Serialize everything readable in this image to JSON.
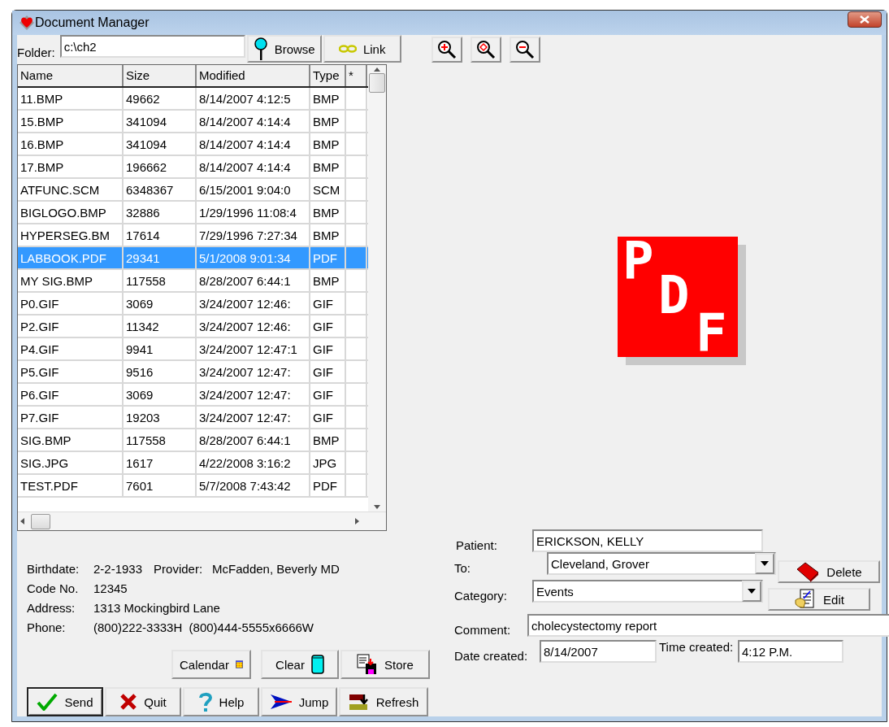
{
  "window": {
    "title": "Document Manager"
  },
  "folder": {
    "label": "Folder:",
    "value": "c:\\ch2"
  },
  "folder_buttons": [
    {
      "kind": "browse",
      "label": "Browse"
    },
    {
      "kind": "link",
      "label": "Link"
    }
  ],
  "zoom_buttons": [
    {
      "kind": "zoom-in"
    },
    {
      "kind": "zoom-reset"
    },
    {
      "kind": "zoom-out"
    }
  ],
  "file_list": {
    "columns": [
      "Name",
      "Size",
      "Modified",
      "Type",
      "*"
    ],
    "rows": [
      {
        "cells": [
          "11.BMP",
          "49662",
          "8/14/2007 4:12:5",
          "BMP"
        ],
        "selected": false
      },
      {
        "cells": [
          "15.BMP",
          "341094",
          "8/14/2007 4:14:4",
          "BMP"
        ],
        "selected": false
      },
      {
        "cells": [
          "16.BMP",
          "341094",
          "8/14/2007 4:14:4",
          "BMP"
        ],
        "selected": false
      },
      {
        "cells": [
          "17.BMP",
          "196662",
          "8/14/2007 4:14:4",
          "BMP"
        ],
        "selected": false
      },
      {
        "cells": [
          "ATFUNC.SCM",
          "6348367",
          "6/15/2001 9:04:0",
          "SCM"
        ],
        "selected": false
      },
      {
        "cells": [
          "BIGLOGO.BMP",
          "32886",
          "1/29/1996 11:08:4",
          "BMP"
        ],
        "selected": false
      },
      {
        "cells": [
          "HYPERSEG.BM",
          "17614",
          "7/29/1996 7:27:34",
          "BMP"
        ],
        "selected": false
      },
      {
        "cells": [
          "LABBOOK.PDF",
          "29341",
          "5/1/2008 9:01:34",
          "PDF"
        ],
        "selected": true
      },
      {
        "cells": [
          "MY SIG.BMP",
          "117558",
          "8/28/2007 6:44:1",
          "BMP"
        ],
        "selected": false
      },
      {
        "cells": [
          "P0.GIF",
          "3069",
          "3/24/2007 12:46:",
          "GIF"
        ],
        "selected": false
      },
      {
        "cells": [
          "P2.GIF",
          "11342",
          "3/24/2007 12:46:",
          "GIF"
        ],
        "selected": false
      },
      {
        "cells": [
          "P4.GIF",
          "9941",
          "3/24/2007 12:47:1",
          "GIF"
        ],
        "selected": false
      },
      {
        "cells": [
          "P5.GIF",
          "9516",
          "3/24/2007 12:47:",
          "GIF"
        ],
        "selected": false
      },
      {
        "cells": [
          "P6.GIF",
          "3069",
          "3/24/2007 12:47:",
          "GIF"
        ],
        "selected": false
      },
      {
        "cells": [
          "P7.GIF",
          "19203",
          "3/24/2007 12:47:",
          "GIF"
        ],
        "selected": false
      },
      {
        "cells": [
          "SIG.BMP",
          "117558",
          "8/28/2007 6:44:1",
          "BMP"
        ],
        "selected": false
      },
      {
        "cells": [
          "SIG.JPG",
          "1617",
          "4/22/2008 3:16:2",
          "JPG"
        ],
        "selected": false
      },
      {
        "cells": [
          "TEST.PDF",
          "7601",
          "5/7/2008 7:43:42",
          "PDF"
        ],
        "selected": false
      }
    ]
  },
  "preview": {
    "letters": [
      "P",
      "D",
      "F"
    ]
  },
  "patient_info": [
    {
      "fields": [
        {
          "label": "Birthdate:",
          "value": "2-2-1933"
        },
        {
          "label": "Provider:",
          "value": "McFadden, Beverly MD"
        }
      ]
    },
    {
      "fields": [
        {
          "label": "Code No.",
          "value": "12345"
        }
      ]
    },
    {
      "fields": [
        {
          "label": "Address:",
          "value": "1313 Mockingbird Lane"
        }
      ]
    },
    {
      "fields": [
        {
          "label": "Phone:",
          "value": "(800)222-3333H  (800)444-5555x6666W"
        }
      ]
    }
  ],
  "tool_buttons": [
    {
      "kind": "calendar",
      "label": "Calendar"
    },
    {
      "kind": "clear",
      "label": "Clear"
    },
    {
      "kind": "store",
      "label": "Store"
    }
  ],
  "action_buttons": [
    {
      "kind": "send",
      "label": "Send",
      "default": true
    },
    {
      "kind": "quit",
      "label": "Quit",
      "default": false
    },
    {
      "kind": "help",
      "label": "Help",
      "default": false
    },
    {
      "kind": "jump",
      "label": "Jump",
      "default": false
    },
    {
      "kind": "refresh",
      "label": "Refresh",
      "default": false
    }
  ],
  "form": {
    "patient": {
      "label": "Patient:",
      "value": "ERICKSON, KELLY"
    },
    "to": {
      "label": "To:",
      "value": "Cleveland, Grover"
    },
    "category": {
      "label": "Category:",
      "value": "Events"
    },
    "comment": {
      "label": "Comment:",
      "value": "cholecystectomy report"
    },
    "date_created": {
      "label": "Date created:",
      "value": "8/14/2007"
    },
    "time_created": {
      "label": "Time created:",
      "value": "4:12 P.M."
    }
  },
  "side_buttons": [
    {
      "kind": "delete",
      "label": "Delete"
    },
    {
      "kind": "edit",
      "label": "Edit"
    }
  ]
}
